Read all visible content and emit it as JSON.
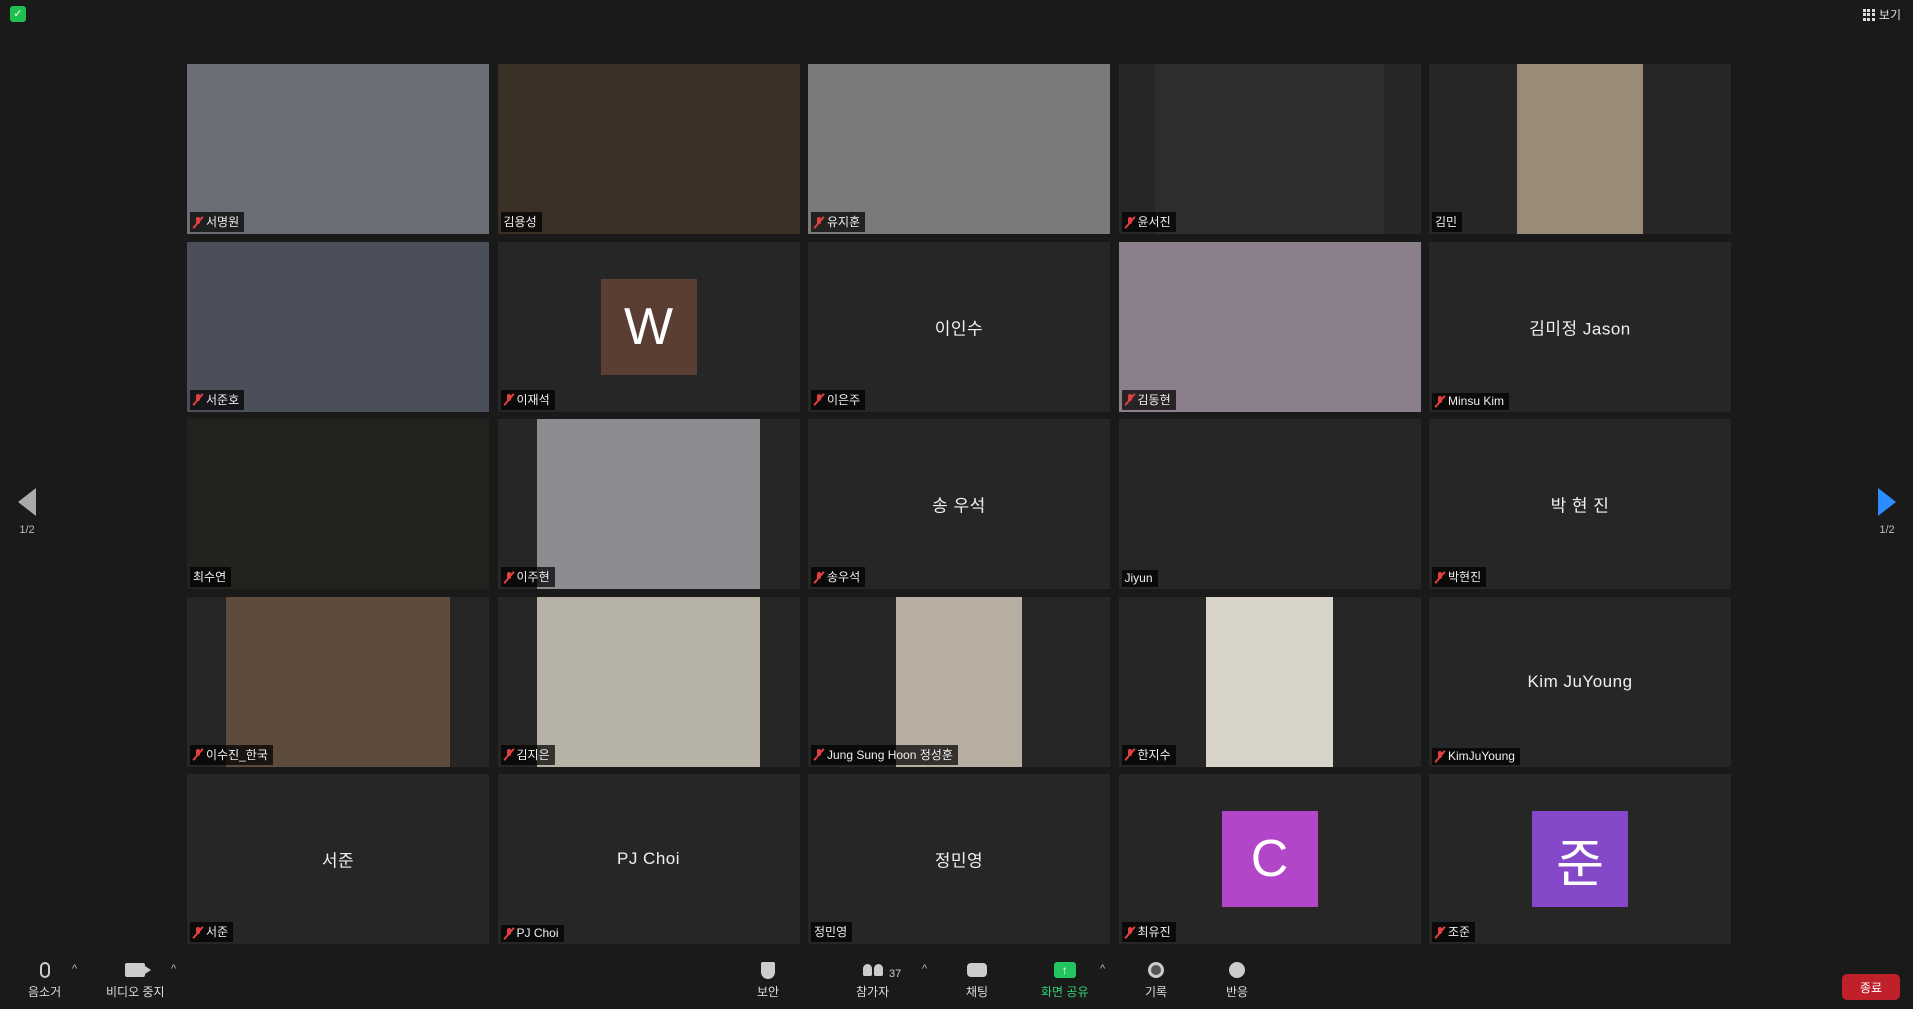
{
  "top": {
    "view_label": "보기"
  },
  "nav": {
    "left_page": "1/2",
    "right_page": "1/2"
  },
  "tiles": [
    {
      "name": "서명원",
      "muted": true,
      "video": true,
      "bg": "#6b6f75",
      "vx": 0,
      "vw": 100
    },
    {
      "name": "김용성",
      "muted": false,
      "video": true,
      "active": true,
      "bg": "#3b3026",
      "vx": 0,
      "vw": 100
    },
    {
      "name": "유지훈",
      "muted": true,
      "video": true,
      "bg": "#7c7a78",
      "vx": 0,
      "vw": 100
    },
    {
      "name": "윤서진",
      "muted": true,
      "video": true,
      "bg": "#2f2e2c",
      "vx": 12,
      "vw": 76
    },
    {
      "name": "김민",
      "muted": false,
      "video": true,
      "bg": "#9a8a78",
      "vx": 29,
      "vw": 42
    },
    {
      "name": "서준호",
      "muted": true,
      "video": true,
      "bg": "#4b4f59",
      "vx": 0,
      "vw": 100
    },
    {
      "name": "이재석",
      "muted": true,
      "video": false,
      "avatar": "W",
      "avatar_color": "#5a3d33"
    },
    {
      "name": "이은주",
      "muted": true,
      "video": false,
      "center": "이인수"
    },
    {
      "name": "김동현",
      "muted": true,
      "video": true,
      "bg": "#8b7f8b",
      "vx": 0,
      "vw": 100
    },
    {
      "name": "Minsu Kim",
      "muted": true,
      "video": false,
      "center": "김미정 Jason"
    },
    {
      "name": "최수연",
      "muted": false,
      "video": true,
      "bg": "#24221f",
      "vx": 0,
      "vw": 100
    },
    {
      "name": "이주현",
      "muted": true,
      "video": true,
      "bg": "#8a8c8f",
      "vx": 13,
      "vw": 74
    },
    {
      "name": "송우석",
      "muted": true,
      "video": false,
      "center": "송 우석"
    },
    {
      "name": "Jiyun",
      "muted": false,
      "video": false,
      "center": ""
    },
    {
      "name": "박현진",
      "muted": true,
      "video": false,
      "center": "박 현 진"
    },
    {
      "name": "이수진_한국",
      "muted": true,
      "video": true,
      "bg": "#5d4b3d",
      "vx": 13,
      "vw": 74
    },
    {
      "name": "김지은",
      "muted": true,
      "video": true,
      "bg": "#b7b2a6",
      "vx": 13,
      "vw": 74
    },
    {
      "name": "Jung Sung Hoon 정성훈",
      "muted": true,
      "video": true,
      "bg": "#b7ada0",
      "vx": 29,
      "vw": 42
    },
    {
      "name": "한지수",
      "muted": true,
      "video": true,
      "bg": "#d8d3c9",
      "vx": 29,
      "vw": 42
    },
    {
      "name": "KimJuYoung",
      "muted": true,
      "video": false,
      "center": "Kim JuYoung"
    },
    {
      "name": "서준",
      "muted": true,
      "video": false,
      "center": "서준"
    },
    {
      "name": "PJ Choi",
      "muted": true,
      "video": false,
      "center": "PJ Choi"
    },
    {
      "name": "정민영",
      "muted": false,
      "video": false,
      "center": "정민영"
    },
    {
      "name": "최유진",
      "muted": true,
      "video": false,
      "avatar": "C",
      "avatar_color": "#b246c8"
    },
    {
      "name": "조준",
      "muted": true,
      "video": false,
      "avatar": "준",
      "avatar_color": "#8448c9"
    }
  ],
  "toolbar": {
    "mute_label": "음소거",
    "video_label": "비디오 중지",
    "security_label": "보안",
    "participants_label": "참가자",
    "participants_count": "37",
    "chat_label": "채팅",
    "share_label": "화면 공유",
    "record_label": "기록",
    "reactions_label": "반응",
    "end_label": "종료"
  }
}
